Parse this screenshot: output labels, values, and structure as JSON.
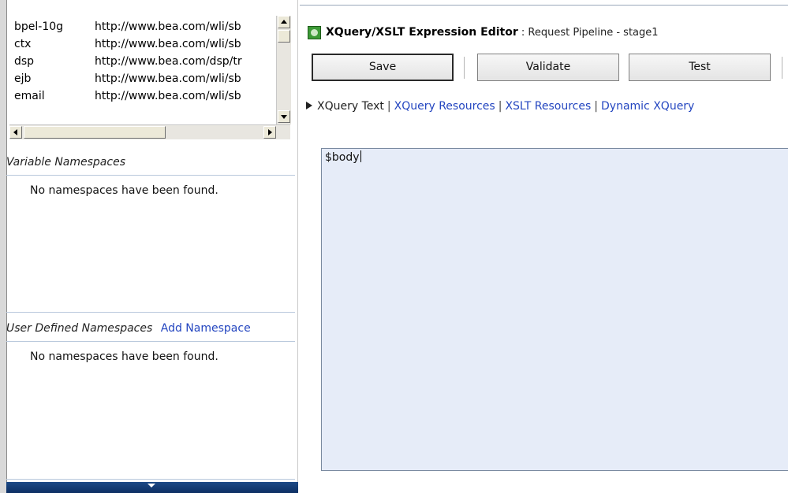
{
  "namespaces": [
    {
      "prefix": "bpel-10g",
      "uri": "http://www.bea.com/wli/sb"
    },
    {
      "prefix": "ctx",
      "uri": "http://www.bea.com/wli/sb"
    },
    {
      "prefix": "dsp",
      "uri": "http://www.bea.com/dsp/tr"
    },
    {
      "prefix": "ejb",
      "uri": "http://www.bea.com/wli/sb"
    },
    {
      "prefix": "email",
      "uri": "http://www.bea.com/wli/sb"
    }
  ],
  "variable_namespaces": {
    "heading": "Variable Namespaces",
    "empty_message": "No namespaces have been found."
  },
  "user_defined_namespaces": {
    "heading": "User Defined Namespaces",
    "add_link": "Add Namespace",
    "empty_message": "No namespaces have been found."
  },
  "editor": {
    "title": "XQuery/XSLT Expression Editor",
    "subtitle": " : Request Pipeline - stage1",
    "icon": "xquery-editor-icon"
  },
  "toolbar": {
    "save_label": "Save",
    "validate_label": "Validate",
    "test_label": "Test"
  },
  "tabs": {
    "current": "XQuery Text",
    "links": [
      "XQuery Resources",
      "XSLT Resources",
      "Dynamic XQuery"
    ],
    "separator": "|"
  },
  "expression": "$body",
  "colors": {
    "link": "#2446c0",
    "editor_bg": "#e6ecf8",
    "bottom_bar": "#1d4a86"
  }
}
